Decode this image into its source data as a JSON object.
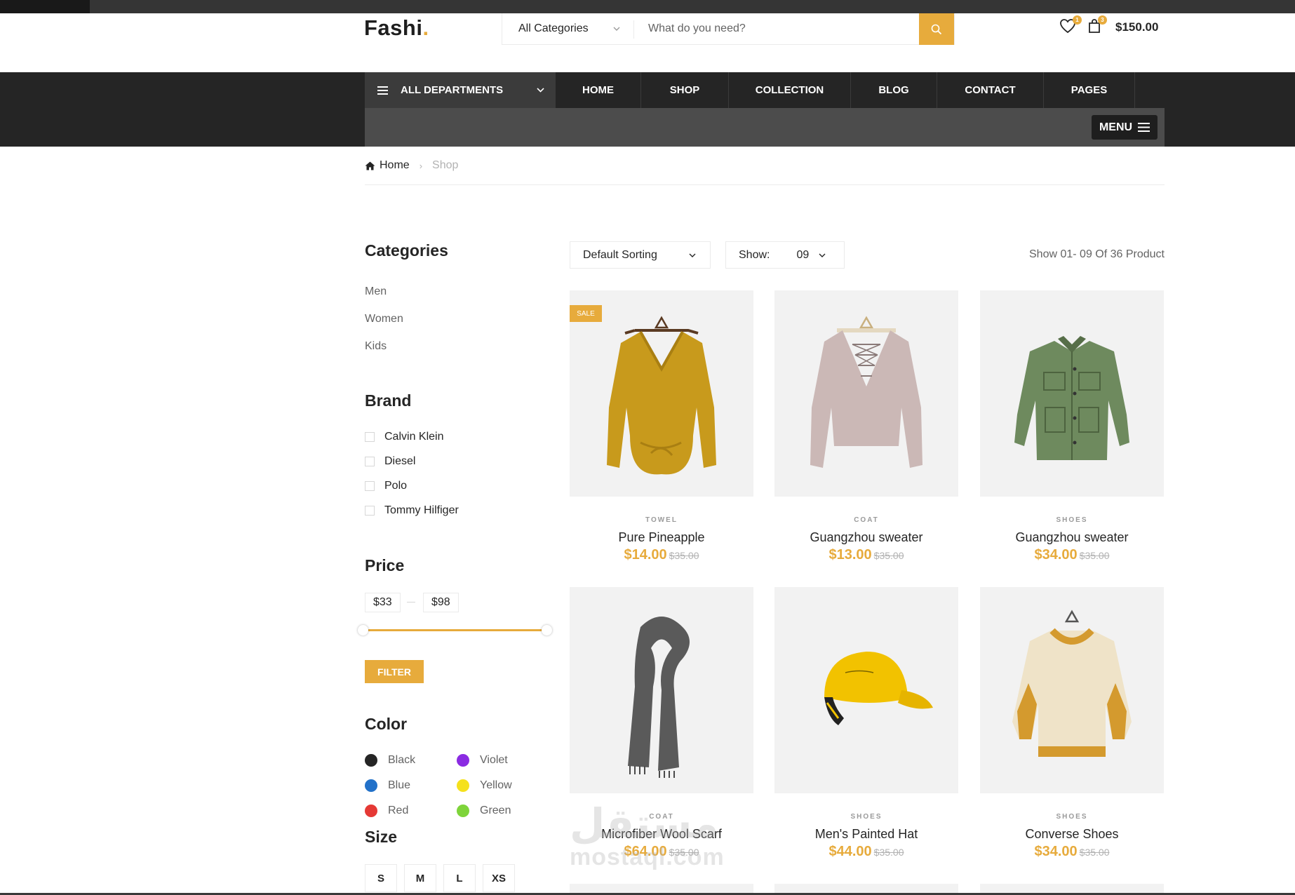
{
  "header": {
    "logo_text": "Fashi",
    "logo_dot": ".",
    "category_select": "All Categories",
    "search_placeholder": "What do you need?",
    "wishlist_count": "1",
    "cart_count": "3",
    "cart_total": "$150.00"
  },
  "nav": {
    "departments_label": "ALL DEPARTMENTS",
    "items": [
      "HOME",
      "SHOP",
      "COLLECTION",
      "BLOG",
      "CONTACT",
      "PAGES"
    ],
    "menu_button": "MENU"
  },
  "breadcrumb": {
    "home": "Home",
    "current": "Shop"
  },
  "sidebar": {
    "categories_title": "Categories",
    "categories": [
      "Men",
      "Women",
      "Kids"
    ],
    "brand_title": "Brand",
    "brands": [
      "Calvin Klein",
      "Diesel",
      "Polo",
      "Tommy Hilfiger"
    ],
    "price_title": "Price",
    "price_min": "$33",
    "price_max": "$98",
    "filter_button": "FILTER",
    "color_title": "Color",
    "colors": [
      {
        "name": "Black",
        "hex": "#252525"
      },
      {
        "name": "Violet",
        "hex": "#8a2be2"
      },
      {
        "name": "Blue",
        "hex": "#2271c9"
      },
      {
        "name": "Yellow",
        "hex": "#f5e11c"
      },
      {
        "name": "Red",
        "hex": "#e53935"
      },
      {
        "name": "Green",
        "hex": "#7ed43a"
      }
    ],
    "size_title": "Size",
    "sizes": [
      "S",
      "M",
      "L",
      "XS"
    ]
  },
  "toolbar": {
    "sorting": "Default Sorting",
    "show_label": "Show:",
    "show_value": "09",
    "result_text": "Show 01- 09 Of 36 Product"
  },
  "products": [
    {
      "category": "TOWEL",
      "name": "Pure Pineapple",
      "price": "$14.00",
      "old_price": "$35.00",
      "badge": "SALE",
      "image": "mustard-twist-sweater"
    },
    {
      "category": "COAT",
      "name": "Guangzhou sweater",
      "price": "$13.00",
      "old_price": "$35.00",
      "badge": "",
      "image": "lilac-lace-up-sweater"
    },
    {
      "category": "SHOES",
      "name": "Guangzhou sweater",
      "price": "$34.00",
      "old_price": "$35.00",
      "badge": "",
      "image": "green-utility-jacket"
    },
    {
      "category": "COAT",
      "name": "Microfiber Wool Scarf",
      "price": "$64.00",
      "old_price": "$35.00",
      "badge": "",
      "image": "grey-wool-scarf"
    },
    {
      "category": "SHOES",
      "name": "Men's Painted Hat",
      "price": "$44.00",
      "old_price": "$35.00",
      "badge": "",
      "image": "yellow-cap"
    },
    {
      "category": "SHOES",
      "name": "Converse Shoes",
      "price": "$34.00",
      "old_price": "$35.00",
      "badge": "",
      "image": "cream-knit-sweater"
    }
  ],
  "watermark": {
    "arabic": "مستقل",
    "latin": "mostaql.com"
  }
}
